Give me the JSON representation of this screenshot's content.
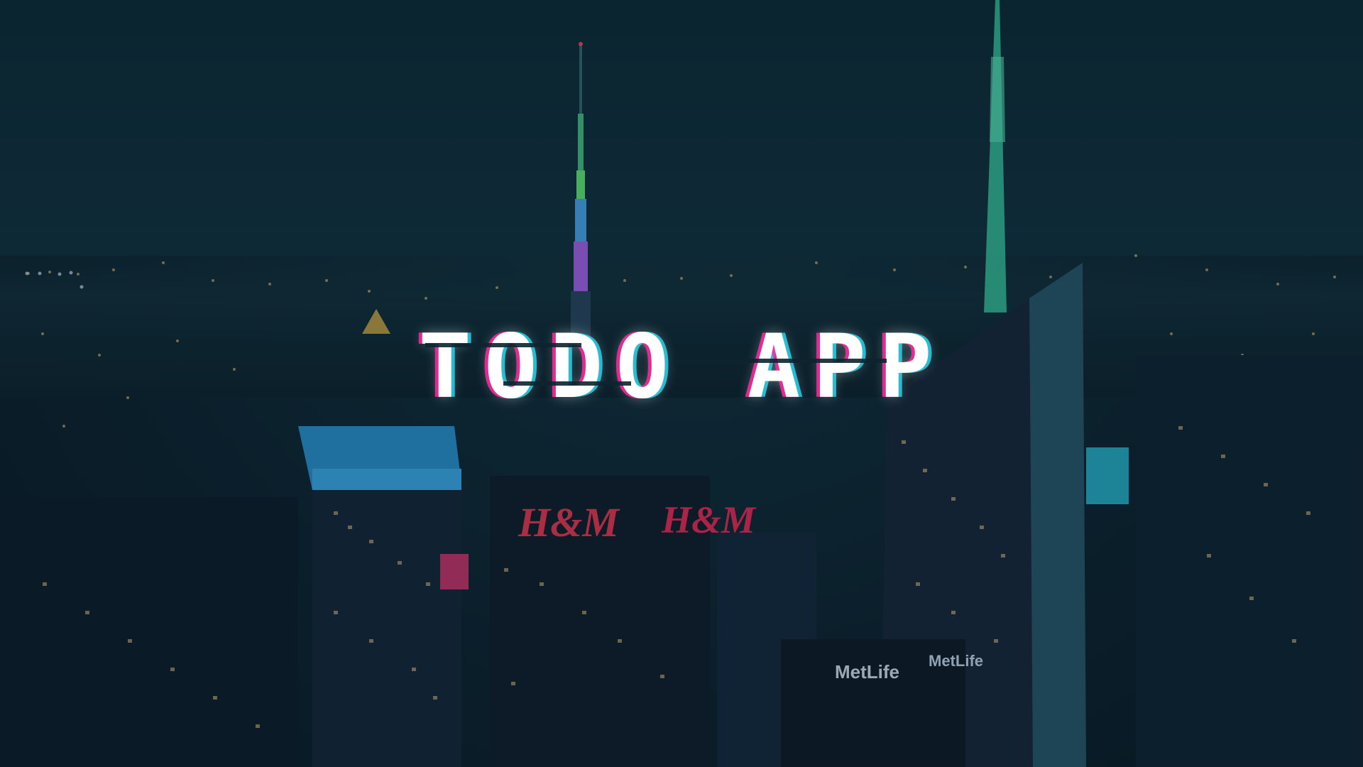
{
  "app": {
    "title": "TODO APP"
  },
  "background": {
    "signs": {
      "hm_front": "H&M",
      "hm_side": "H&M",
      "metlife_front": "MetLife",
      "metlife_side": "MetLife"
    }
  },
  "colors": {
    "title_text": "#ffffff",
    "glitch_magenta": "#ff28a0",
    "glitch_cyan": "#28e6ff",
    "sky": "#0c2a36",
    "neon_blue": "#2fb6ff",
    "neon_green": "#3df0a0",
    "sign_red": "#ff3a55"
  }
}
